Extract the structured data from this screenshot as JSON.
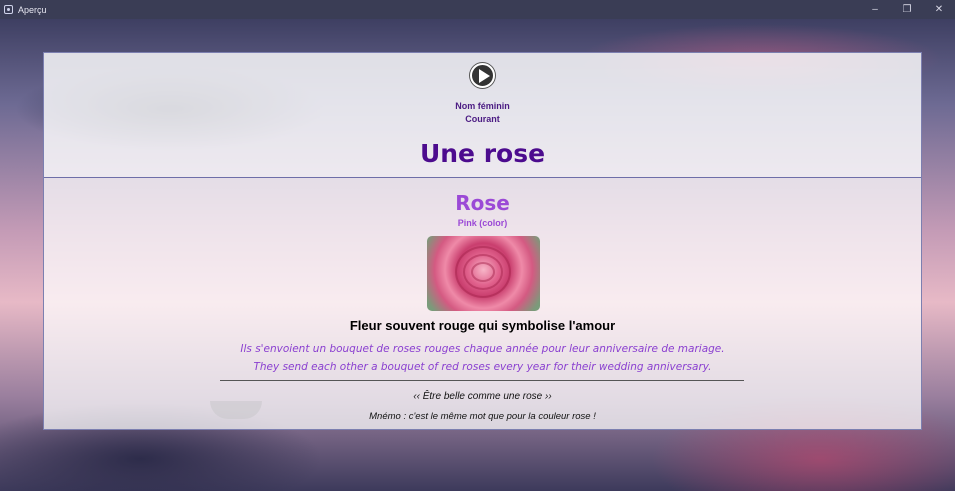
{
  "window": {
    "title": "Aperçu",
    "controls": {
      "minimize": "–",
      "restore": "❐",
      "close": "✕"
    }
  },
  "entry": {
    "grammar": "Nom féminin",
    "register": "Courant",
    "word": "Une rose",
    "translation_title": "Rose",
    "translation_subtitle": "Pink (color)",
    "definition": "Fleur souvent rouge qui symbolise l'amour",
    "example_fr": "Ils s'envoient un bouquet de roses rouges chaque année pour leur anniversaire de mariage.",
    "example_en": "They send each other a bouquet of red roses every year for their wedding anniversary.",
    "expression": "‹‹ Être belle comme une rose ››",
    "memo": "Mnémo : c'est le même mot que pour la couleur rose !"
  },
  "icons": {
    "play": "play-icon",
    "app": "app-icon"
  },
  "colors": {
    "word": "#4c0b8e",
    "translation": "#9b49d6",
    "example": "#8a3fd0"
  }
}
